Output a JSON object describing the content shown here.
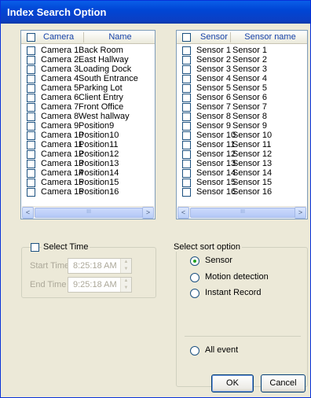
{
  "window": {
    "title": "Index Search Option"
  },
  "cameras": {
    "header_col1": "Camera",
    "header_col2": "Name",
    "rows": [
      {
        "id": "Camera 1",
        "name": "Back Room"
      },
      {
        "id": "Camera 2",
        "name": "East Hallway"
      },
      {
        "id": "Camera 3",
        "name": "Loading Dock"
      },
      {
        "id": "Camera 4",
        "name": "South Entrance"
      },
      {
        "id": "Camera 5",
        "name": "Parking Lot"
      },
      {
        "id": "Camera 6",
        "name": "Client Entry"
      },
      {
        "id": "Camera 7",
        "name": "Front Office"
      },
      {
        "id": "Camera 8",
        "name": "West hallway"
      },
      {
        "id": "Camera 9",
        "name": "Position9"
      },
      {
        "id": "Camera 10",
        "name": "Position10"
      },
      {
        "id": "Camera 11",
        "name": "Position11"
      },
      {
        "id": "Camera 12",
        "name": "Position12"
      },
      {
        "id": "Camera 13",
        "name": "Position13"
      },
      {
        "id": "Camera 14",
        "name": "Position14"
      },
      {
        "id": "Camera 15",
        "name": "Position15"
      },
      {
        "id": "Camera 16",
        "name": "Position16"
      }
    ]
  },
  "sensors": {
    "header_col1": "Sensor",
    "header_col2": "Sensor name",
    "rows": [
      {
        "id": "Sensor 1",
        "name": "Sensor 1"
      },
      {
        "id": "Sensor 2",
        "name": "Sensor 2"
      },
      {
        "id": "Sensor 3",
        "name": "Sensor 3"
      },
      {
        "id": "Sensor 4",
        "name": "Sensor 4"
      },
      {
        "id": "Sensor 5",
        "name": "Sensor 5"
      },
      {
        "id": "Sensor 6",
        "name": "Sensor 6"
      },
      {
        "id": "Sensor 7",
        "name": "Sensor 7"
      },
      {
        "id": "Sensor 8",
        "name": "Sensor 8"
      },
      {
        "id": "Sensor 9",
        "name": "Sensor 9"
      },
      {
        "id": "Sensor 10",
        "name": "Sensor 10"
      },
      {
        "id": "Sensor 11",
        "name": "Sensor 11"
      },
      {
        "id": "Sensor 12",
        "name": "Sensor 12"
      },
      {
        "id": "Sensor 13",
        "name": "Sensor 13"
      },
      {
        "id": "Sensor 14",
        "name": "Sensor 14"
      },
      {
        "id": "Sensor 15",
        "name": "Sensor 15"
      },
      {
        "id": "Sensor 16",
        "name": "Sensor 16"
      }
    ]
  },
  "scrollbar": {
    "left_arrow": "<",
    "right_arrow": ">",
    "thumb_grip": "III"
  },
  "time": {
    "group_label": "Select Time",
    "start_label": "Start Time",
    "start_value": "8:25:18 AM",
    "end_label": "End Time",
    "end_value": "9:25:18 AM",
    "spin_up": "▲",
    "spin_down": "▼"
  },
  "sort": {
    "group_label": "Select sort option",
    "options": [
      "Sensor",
      "Motion detection",
      "Instant Record"
    ],
    "selected": "Sensor",
    "all_event": "All event"
  },
  "buttons": {
    "ok": "OK",
    "cancel": "Cancel"
  }
}
